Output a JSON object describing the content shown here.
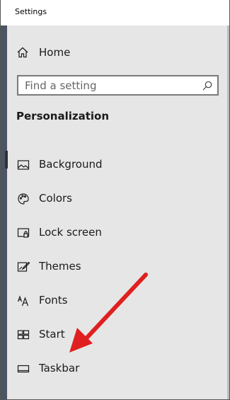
{
  "window": {
    "title": "Settings"
  },
  "nav": {
    "home_label": "Home",
    "search_placeholder": "Find a setting",
    "section_title": "Personalization",
    "items": [
      {
        "label": "Background",
        "icon": "picture-icon",
        "selected": true
      },
      {
        "label": "Colors",
        "icon": "palette-icon"
      },
      {
        "label": "Lock screen",
        "icon": "lock-screen-icon"
      },
      {
        "label": "Themes",
        "icon": "themes-icon"
      },
      {
        "label": "Fonts",
        "icon": "fonts-icon"
      },
      {
        "label": "Start",
        "icon": "start-icon"
      },
      {
        "label": "Taskbar",
        "icon": "taskbar-icon"
      }
    ]
  },
  "annotation": {
    "color": "#e02020"
  }
}
